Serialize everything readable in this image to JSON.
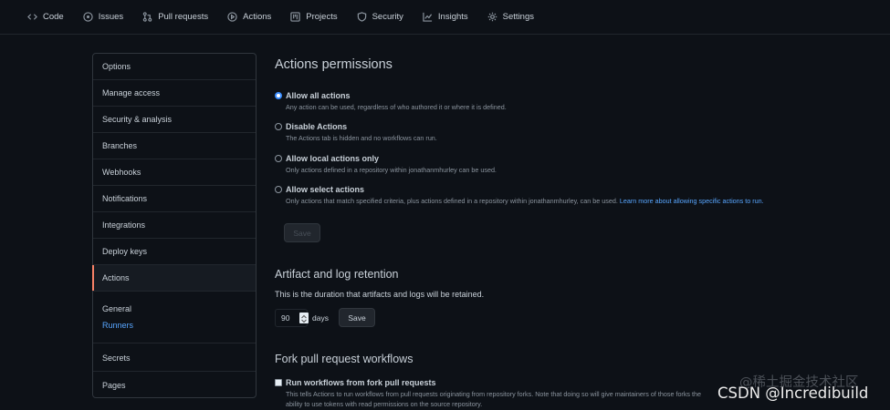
{
  "nav": {
    "tabs": [
      {
        "label": "Code",
        "icon": "code-icon"
      },
      {
        "label": "Issues",
        "icon": "issue-icon"
      },
      {
        "label": "Pull requests",
        "icon": "pull-request-icon"
      },
      {
        "label": "Actions",
        "icon": "play-icon"
      },
      {
        "label": "Projects",
        "icon": "project-icon"
      },
      {
        "label": "Security",
        "icon": "shield-icon"
      },
      {
        "label": "Insights",
        "icon": "graph-icon"
      },
      {
        "label": "Settings",
        "icon": "gear-icon"
      }
    ]
  },
  "sidebar": {
    "items": [
      {
        "label": "Options"
      },
      {
        "label": "Manage access"
      },
      {
        "label": "Security & analysis"
      },
      {
        "label": "Branches"
      },
      {
        "label": "Webhooks"
      },
      {
        "label": "Notifications"
      },
      {
        "label": "Integrations"
      },
      {
        "label": "Deploy keys"
      },
      {
        "label": "Actions"
      }
    ],
    "group": {
      "general": "General",
      "runners": "Runners"
    },
    "items2": [
      {
        "label": "Secrets"
      },
      {
        "label": "Pages"
      }
    ]
  },
  "permissions": {
    "title": "Actions permissions",
    "options": [
      {
        "label": "Allow all actions",
        "desc": "Any action can be used, regardless of who authored it or where it is defined.",
        "checked": true
      },
      {
        "label": "Disable Actions",
        "desc": "The Actions tab is hidden and no workflows can run.",
        "checked": false
      },
      {
        "label": "Allow local actions only",
        "desc": "Only actions defined in a repository within jonathanmhurley can be used.",
        "checked": false
      },
      {
        "label": "Allow select actions",
        "desc": "Only actions that match specified criteria, plus actions defined in a repository within jonathanmhurley, can be used.",
        "link": "Learn more about allowing specific actions to run.",
        "checked": false
      }
    ],
    "save_label": "Save"
  },
  "retention": {
    "title": "Artifact and log retention",
    "desc": "This is the duration that artifacts and logs will be retained.",
    "value": "90",
    "unit": "days",
    "save_label": "Save"
  },
  "fork": {
    "title": "Fork pull request workflows",
    "checkbox_label": "Run workflows from fork pull requests",
    "checkbox_desc": "This tells Actions to run workflows from pull requests originating from repository forks. Note that doing so will give maintainers of those forks the ability to use tokens with read permissions on the source repository."
  },
  "watermarks": {
    "line1": "@稀土掘金技术社区",
    "line2": "CSDN @Incredibuild"
  }
}
